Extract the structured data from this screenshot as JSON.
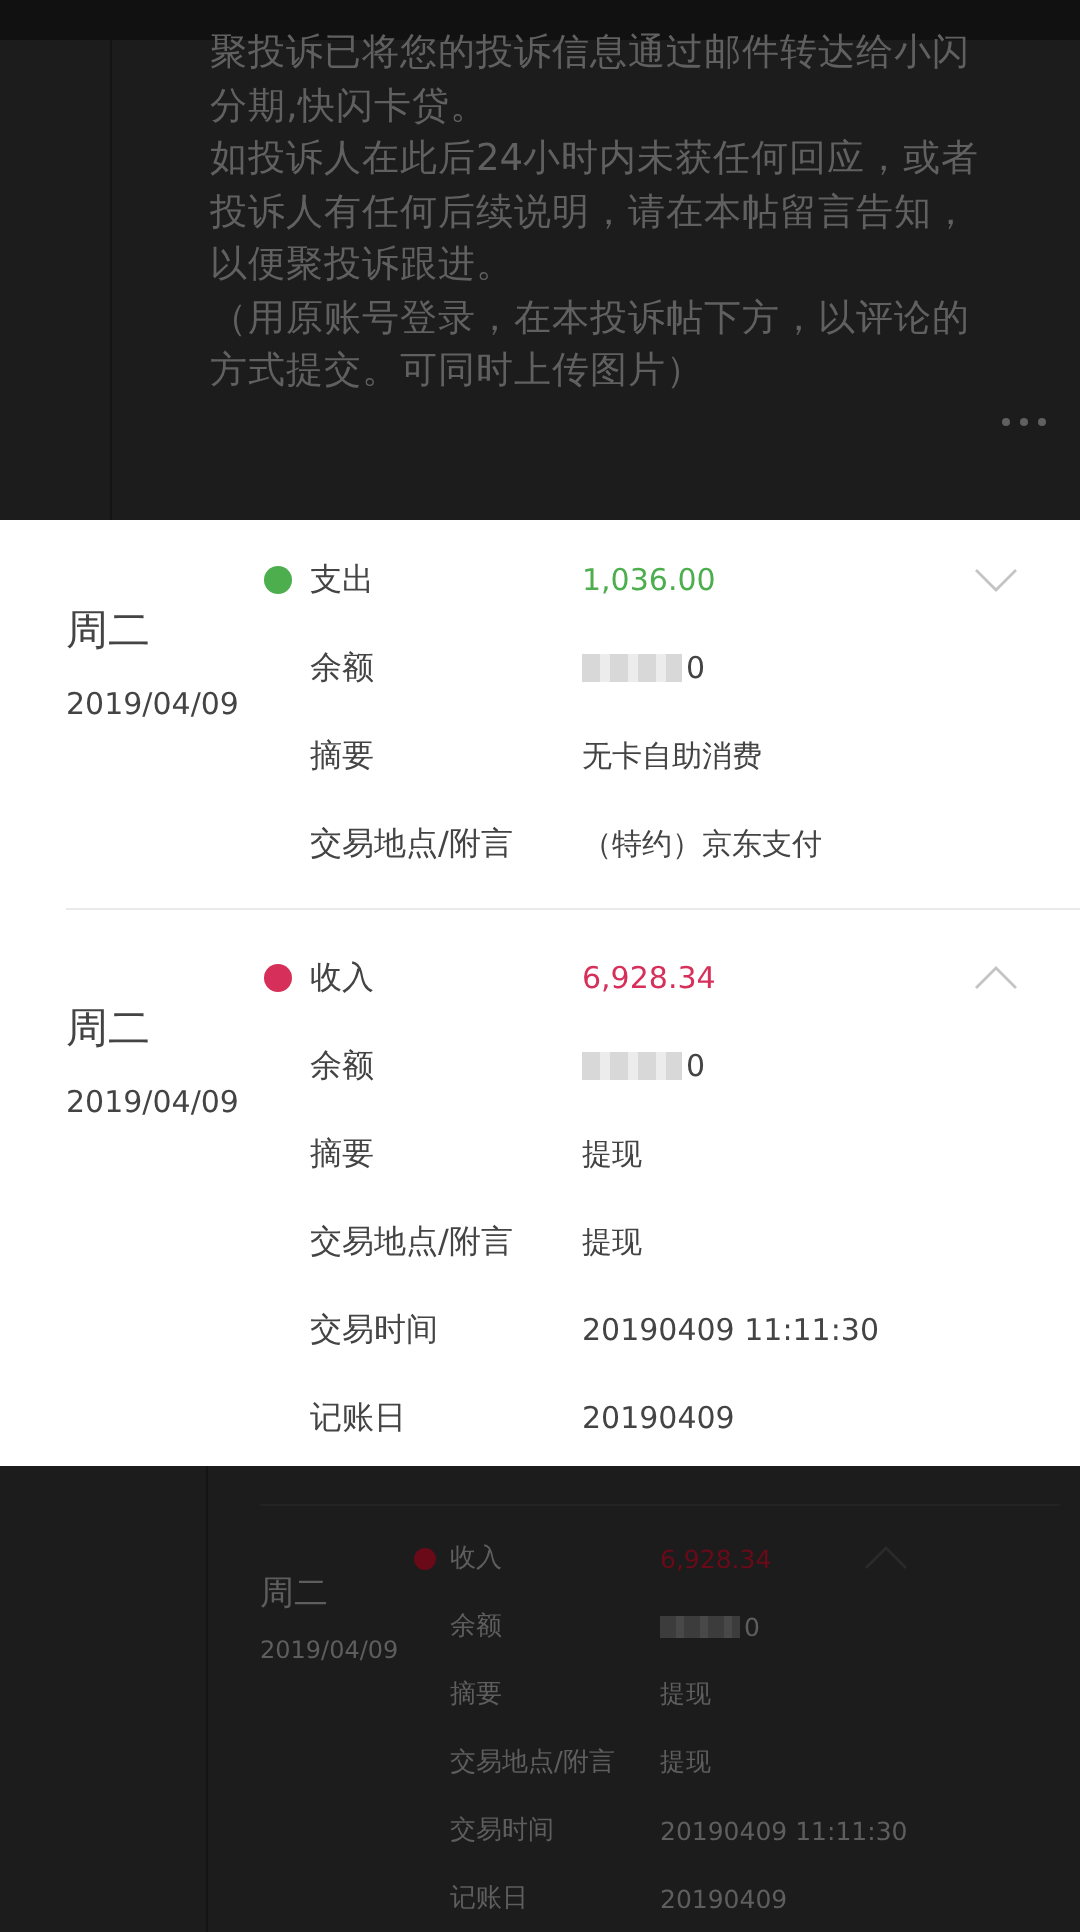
{
  "post": {
    "paragraphs": [
      "聚投诉已将您的投诉信息通过邮件转达给小闪分期,快闪卡贷。",
      "如投诉人在此后24小时内未获任何回应，或者投诉人有任何后续说明，请在本帖留言告知，以便聚投诉跟进。",
      "（用原账号登录，在本投诉帖下方，以评论的方式提交。可同时上传图片）"
    ]
  },
  "transactions": [
    {
      "weekday": "周二",
      "date": "2019/04/09",
      "type": "支出",
      "amount": "1,036.00",
      "color": "#4cae4c",
      "expanded": false,
      "fields": [
        {
          "kind": "masked",
          "label": "余额",
          "value": "0"
        },
        {
          "kind": "text",
          "label": "摘要",
          "value": "无卡自助消费"
        },
        {
          "kind": "text",
          "label": "交易地点/附言",
          "value": "（特约）京东支付"
        }
      ]
    },
    {
      "weekday": "周二",
      "date": "2019/04/09",
      "type": "收入",
      "amount": "6,928.34",
      "color": "#d6305a",
      "expanded": true,
      "fields": [
        {
          "kind": "masked",
          "label": "余额",
          "value": "0"
        },
        {
          "kind": "text",
          "label": "摘要",
          "value": "提现"
        },
        {
          "kind": "text",
          "label": "交易地点/附言",
          "value": "提现"
        },
        {
          "kind": "text",
          "label": "交易时间",
          "value": "20190409 11:11:30"
        },
        {
          "kind": "text",
          "label": "记账日",
          "value": "20190409"
        }
      ]
    }
  ],
  "background_transactions": [
    {
      "weekday": "周二",
      "date": "2019/04/09",
      "type": "收入",
      "amount": "6,928.34",
      "color": "#6a0a18",
      "expanded": true,
      "fields": [
        {
          "kind": "masked",
          "label": "余额",
          "value": "0"
        },
        {
          "kind": "text",
          "label": "摘要",
          "value": "提现"
        },
        {
          "kind": "text",
          "label": "交易地点/附言",
          "value": "提现"
        },
        {
          "kind": "text",
          "label": "交易时间",
          "value": "20190409 11:11:30"
        },
        {
          "kind": "text",
          "label": "记账日",
          "value": "20190409"
        }
      ]
    }
  ]
}
